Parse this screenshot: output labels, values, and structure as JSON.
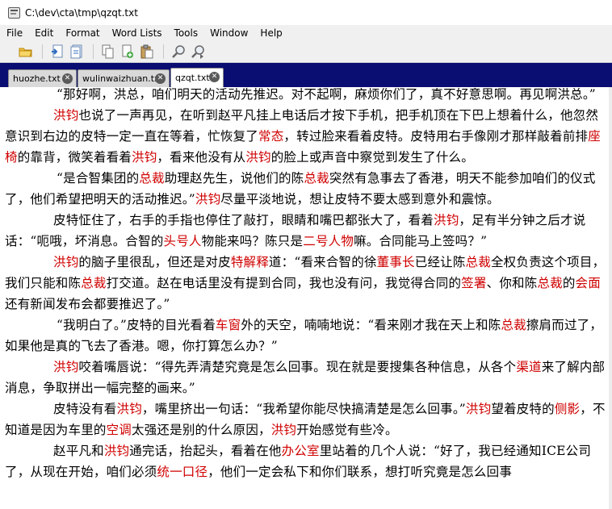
{
  "window": {
    "title": "C:\\dev\\cta\\tmp\\qzqt.txt"
  },
  "menu": [
    {
      "id": "file",
      "label": "File"
    },
    {
      "id": "edit",
      "label": "Edit"
    },
    {
      "id": "format",
      "label": "Format"
    },
    {
      "id": "word-lists",
      "label": "Word Lists"
    },
    {
      "id": "tools",
      "label": "Tools"
    },
    {
      "id": "window",
      "label": "Window"
    },
    {
      "id": "help",
      "label": "Help"
    }
  ],
  "toolbar": {
    "icons": [
      "open-folder-icon",
      "save-icon",
      "save-all-icon",
      "copy-icon",
      "new-document-icon",
      "paste-icon",
      "search-icon",
      "search-next-icon"
    ]
  },
  "tabs": [
    {
      "label": "huozhe.txt",
      "active": false
    },
    {
      "label": "wulinwaizhuan.txt",
      "active": false
    },
    {
      "label": "qzqt.txt",
      "active": true
    }
  ],
  "colors": {
    "tab_bar_bg": "#0a0d72",
    "highlight": "#d00000"
  },
  "document": {
    "paragraphs": [
      [
        {
          "t": "“那好啊，洪总，咱们明天的活动先推迟。对不起啊，麻烦你们了，真不好意思啊。再见啊洪总。”"
        }
      ],
      [
        {
          "t": "洪钧",
          "h": true
        },
        {
          "t": "也说了一声再见，在听到赵平凡挂上电话后才按下手机，把手机顶在下巴上想着什么，他忽然意识到右边的皮特一定一直在等着，忙恢复了"
        },
        {
          "t": "常态",
          "h": true
        },
        {
          "t": "，转过脸来看着皮特。皮特用右手像刚才那样敲着前排"
        },
        {
          "t": "座椅",
          "h": true
        },
        {
          "t": "的靠背，微笑着看着"
        },
        {
          "t": "洪钧",
          "h": true
        },
        {
          "t": "，看来他没有从"
        },
        {
          "t": "洪钧",
          "h": true
        },
        {
          "t": "的脸上或声音中察觉到发生了什么。"
        }
      ],
      [
        {
          "t": "“是合智集团的"
        },
        {
          "t": "总裁",
          "h": true
        },
        {
          "t": "助理赵先生，说他们的陈"
        },
        {
          "t": "总裁",
          "h": true
        },
        {
          "t": "突然有急事去了香港，明天不能参加咱们的仪式了，他们希望把明天的活动推迟。”"
        },
        {
          "t": "洪钧",
          "h": true
        },
        {
          "t": "尽量平淡地说，想让皮特不要太感到意外和震惊。"
        }
      ],
      [
        {
          "t": "皮特怔住了，右手的手指也停住了敲打，眼睛和嘴巴都张大了，看着"
        },
        {
          "t": "洪钧",
          "h": true
        },
        {
          "t": "，足有半分钟之后才说话：“呃哦，坏消息。合智的"
        },
        {
          "t": "头号人",
          "h": true
        },
        {
          "t": "物能来吗？陈只是"
        },
        {
          "t": "二号人物",
          "h": true
        },
        {
          "t": "嘛。合同能马上签吗？”"
        }
      ],
      [
        {
          "t": "洪钧",
          "h": true
        },
        {
          "t": "的脑子里很乱，但还是对皮"
        },
        {
          "t": "特解释",
          "h": true
        },
        {
          "t": "道：“看来合智的徐"
        },
        {
          "t": "董事长",
          "h": true
        },
        {
          "t": "已经让陈"
        },
        {
          "t": "总裁",
          "h": true
        },
        {
          "t": "全权负责这个项目，我们只能和陈"
        },
        {
          "t": "总裁",
          "h": true
        },
        {
          "t": "打交道。赵在电话里没有提到合同，我也没有问，我觉得合同的"
        },
        {
          "t": "签署",
          "h": true
        },
        {
          "t": "、你和陈"
        },
        {
          "t": "总裁",
          "h": true
        },
        {
          "t": "的"
        },
        {
          "t": "会面",
          "h": true
        },
        {
          "t": "还有新闻发布会都要推迟了。”"
        }
      ],
      [
        {
          "t": "“我明白了。”皮特的目光看着"
        },
        {
          "t": "车窗",
          "h": true
        },
        {
          "t": "外的天空，喃喃地说：“看来刚才我在天上和陈"
        },
        {
          "t": "总裁",
          "h": true
        },
        {
          "t": "擦肩而过了，如果他是真的飞去了香港。嗯，你打算怎么办？”"
        }
      ],
      [
        {
          "t": "洪钧",
          "h": true
        },
        {
          "t": "咬着嘴唇说：“得先弄清楚究竟是怎么回事。现在就是要搜集各种信息，从各个"
        },
        {
          "t": "渠道",
          "h": true
        },
        {
          "t": "来了解内部消息，争取拼出一幅完整的画来。”"
        }
      ],
      [
        {
          "t": "皮特没有看"
        },
        {
          "t": "洪钧",
          "h": true
        },
        {
          "t": "，嘴里挤出一句话：“我希望你能尽快搞清楚是怎么回事。”"
        },
        {
          "t": "洪钧",
          "h": true
        },
        {
          "t": "望着皮特的"
        },
        {
          "t": "侧影",
          "h": true
        },
        {
          "t": "，不知道是因为车里的"
        },
        {
          "t": "空调",
          "h": true
        },
        {
          "t": "太强还是别的什么原因，"
        },
        {
          "t": "洪钧",
          "h": true
        },
        {
          "t": "开始感觉有些冷。"
        }
      ],
      [
        {
          "t": "赵平凡和"
        },
        {
          "t": "洪钧",
          "h": true
        },
        {
          "t": "通完话，抬起头，看着在他"
        },
        {
          "t": "办公室",
          "h": true
        },
        {
          "t": "里站着的几个人说：“好了，我已经通知ICE公司了，从现在开始，咱们必须"
        },
        {
          "t": "统一口径",
          "h": true
        },
        {
          "t": "，他们一定会私下和你们联系，想打听究竟是怎么回事"
        }
      ]
    ]
  }
}
